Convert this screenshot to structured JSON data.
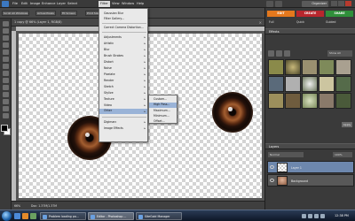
{
  "menubar": {
    "items": [
      "File",
      "Edit",
      "Image",
      "Enhance",
      "Layer",
      "Select",
      "Filter",
      "View",
      "Window",
      "Help"
    ],
    "organizer_label": "Organizer"
  },
  "options_bar": {
    "buttons": [
      "Scroll All Windows",
      "Actual Pixels",
      "Fit Screen",
      "Print Size"
    ]
  },
  "document": {
    "tab_title": "1 copy @ 66% (Layer 1, RGB/8)",
    "close_label": "×"
  },
  "statusbar": {
    "zoom": "66%",
    "info": "Doc: 1.37M/1.37M"
  },
  "filter_menu": {
    "top_items": [
      "Gaussian Blur",
      "Filter Gallery..."
    ],
    "camera_item": "Correct Camera Distortion...",
    "categories": [
      "Adjustments",
      "Artistic",
      "Blur",
      "Brush Strokes",
      "Distort",
      "Noise",
      "Pixelate",
      "Render",
      "Sketch",
      "Stylize",
      "Texture",
      "Video",
      "Other"
    ],
    "bottom_items": [
      "Digimarc",
      "Image Effects"
    ],
    "highlighted": "Other"
  },
  "other_submenu": {
    "items": [
      "Custom...",
      "High Pass...",
      "Maximum...",
      "Minimum...",
      "Offset..."
    ],
    "highlighted": "High Pass..."
  },
  "right_panel": {
    "mode_tabs": [
      "EDIT",
      "CREATE",
      "SHARE"
    ],
    "sub_tabs": [
      "Full",
      "Quick",
      "Guided"
    ],
    "effects_header": "Effects",
    "effects_dropdown": "Show All",
    "apply_label": "Apply",
    "layers_header": "Layers",
    "blend_mode": "Normal",
    "opacity": "100%",
    "layers": [
      "Layer 1",
      "Background"
    ]
  },
  "taskbar": {
    "tasks": [
      "Problem loading pa...",
      "Editor - Photoshop ...",
      "SiteGold Manager"
    ],
    "clock": "12:38 PM"
  },
  "colors": {
    "edit_tab": "#e4781d",
    "create_tab": "#b8262d",
    "share_tab": "#2f8f3a",
    "menu_highlight": "#9ab3d7"
  }
}
